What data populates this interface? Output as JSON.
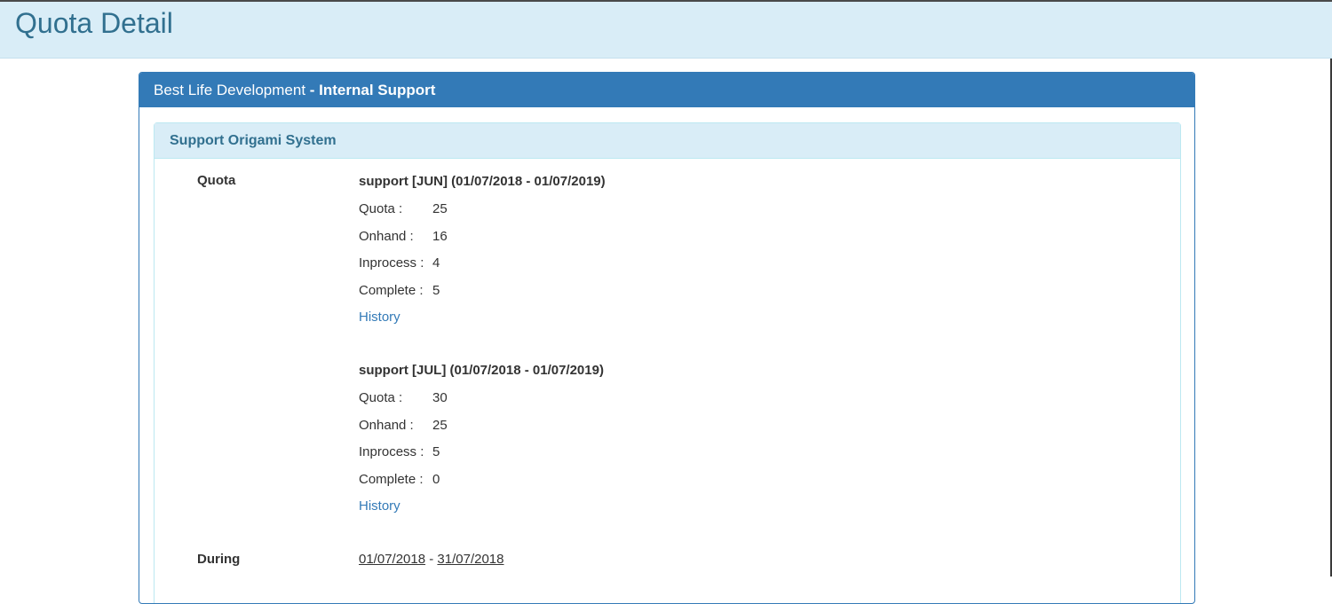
{
  "page": {
    "title": "Quota Detail"
  },
  "panel": {
    "company": "Best Life Development",
    "separator": " - ",
    "department": "Internal Support",
    "section": {
      "title": "Support Origami System",
      "quota_label": "Quota",
      "during_label": "During",
      "quotas": [
        {
          "title": "support [JUN] (01/07/2018 - 01/07/2019)",
          "rows": [
            {
              "key": "Quota :",
              "value": "25"
            },
            {
              "key": "Onhand :",
              "value": "16"
            },
            {
              "key": "Inprocess :",
              "value": "4"
            },
            {
              "key": "Complete :",
              "value": "5"
            }
          ],
          "history_label": "History"
        },
        {
          "title": "support [JUL] (01/07/2018 - 01/07/2019)",
          "rows": [
            {
              "key": "Quota :",
              "value": "30"
            },
            {
              "key": "Onhand :",
              "value": "25"
            },
            {
              "key": "Inprocess :",
              "value": "5"
            },
            {
              "key": "Complete :",
              "value": "0"
            }
          ],
          "history_label": "History"
        }
      ],
      "during": {
        "start": "01/07/2018",
        "dash": " - ",
        "end": "31/07/2018"
      }
    }
  },
  "colors": {
    "primary": "#337ab7",
    "info_bg": "#d9edf7",
    "info_text": "#31708f"
  }
}
